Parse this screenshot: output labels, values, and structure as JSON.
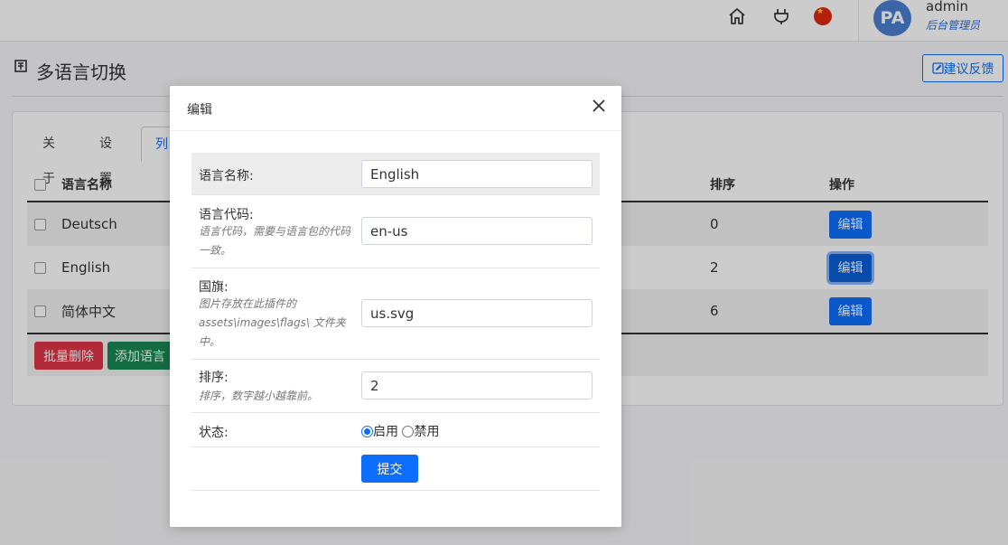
{
  "header": {
    "icons": [
      "home-icon",
      "plug-icon",
      "china-flag-icon"
    ],
    "avatar_initials": "PA",
    "user_name": "admin",
    "user_role": "后台管理员"
  },
  "page": {
    "title": "多语言切换",
    "feedback_button": "建议反馈",
    "tabs": [
      "关于",
      "设置",
      "列"
    ]
  },
  "table": {
    "columns": {
      "name": "语言名称",
      "sort": "排序",
      "action": "操作"
    },
    "rows": [
      {
        "name": "Deutsch",
        "sort": "0",
        "action": "编辑"
      },
      {
        "name": "English",
        "sort": "2",
        "action": "编辑"
      },
      {
        "name": "简体中文",
        "sort": "6",
        "action": "编辑"
      }
    ],
    "bulk_delete": "批量删除",
    "add_language": "添加语言"
  },
  "modal": {
    "title": "编辑",
    "fields": {
      "name": {
        "label": "语言名称:",
        "value": "English"
      },
      "code": {
        "label": "语言代码:",
        "help": "语言代码，需要与语言包的代码一致。",
        "value": "en-us"
      },
      "flag": {
        "label": "国旗:",
        "help": "图片存放在此插件的 assets\\images\\flags\\ 文件夹中。",
        "value": "us.svg"
      },
      "sort": {
        "label": "排序:",
        "help": "排序，数字越小越靠前。",
        "value": "2"
      },
      "status": {
        "label": "状态:",
        "option_enabled": "启用",
        "option_disabled": "禁用",
        "selected": "启用"
      }
    },
    "submit": "提交"
  },
  "colors": {
    "primary": "#0d6efd",
    "danger": "#dc3545",
    "success": "#198754",
    "flag_red": "#de2910"
  }
}
